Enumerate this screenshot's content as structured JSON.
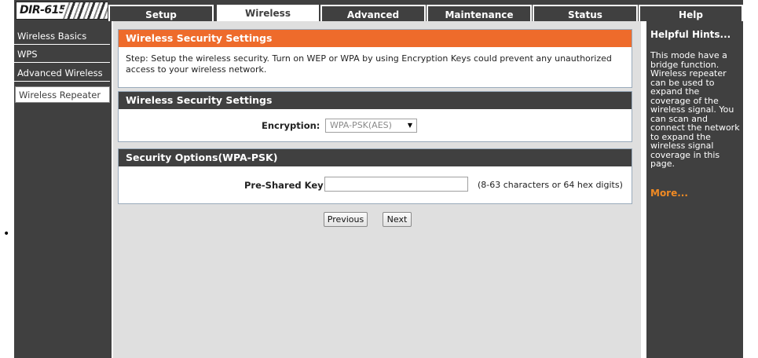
{
  "brand": {
    "model": "DIR-615"
  },
  "tabs": [
    {
      "label": "Setup"
    },
    {
      "label": "Wireless"
    },
    {
      "label": "Advanced"
    },
    {
      "label": "Maintenance"
    },
    {
      "label": "Status"
    },
    {
      "label": "Help"
    }
  ],
  "sidebar": {
    "items": [
      {
        "label": "Wireless Basics"
      },
      {
        "label": "WPS"
      },
      {
        "label": "Advanced Wireless"
      },
      {
        "label": "Wireless Repeater"
      }
    ]
  },
  "intro": {
    "title": "Wireless Security Settings",
    "text": "Step: Setup the wireless security. Turn on WEP or WPA by using Encryption Keys could prevent any unauthorized access to your wireless network."
  },
  "security": {
    "title": "Wireless Security Settings",
    "encryption_label": "Encryption:",
    "encryption_value": "WPA-PSK(AES)"
  },
  "options": {
    "title": "Security Options(WPA-PSK)",
    "psk_label": "Pre-Shared Key:",
    "psk_value": "",
    "psk_hint": "(8-63 characters or 64 hex digits)"
  },
  "buttons": {
    "previous": "Previous",
    "next": "Next"
  },
  "help": {
    "title": "Helpful Hints...",
    "body": "This mode have a bridge function. Wireless repeater can be used to expand the coverage of the wireless signal. You can scan and connect the network to expand the wireless signal coverage in this page.",
    "more": "More..."
  },
  "colors": {
    "dark": "#404040",
    "accent_orange": "#ee6b2b",
    "more_link": "#f08a24",
    "content_bg": "#dfdfdf"
  }
}
